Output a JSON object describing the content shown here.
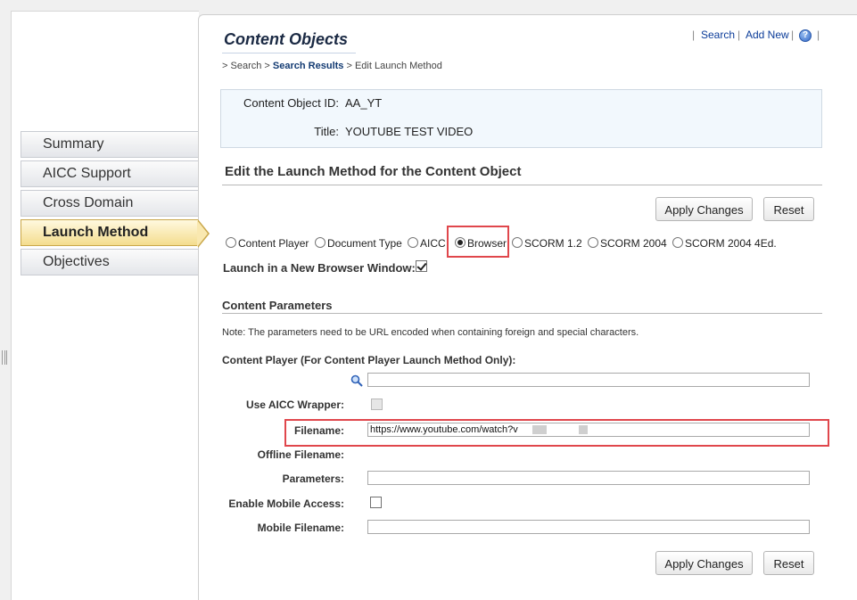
{
  "sidebar": {
    "items": [
      {
        "label": "Summary"
      },
      {
        "label": "AICC Support"
      },
      {
        "label": "Cross Domain"
      },
      {
        "label": "Launch Method"
      },
      {
        "label": "Objectives"
      }
    ],
    "active_index": 3
  },
  "header": {
    "title": "Content Objects",
    "links": {
      "search": "Search",
      "add_new": "Add New",
      "separator": "|"
    },
    "help_icon": "help-icon"
  },
  "breadcrumb": {
    "sep": ">",
    "items": [
      "Search",
      "Search Results",
      "Edit Launch Method"
    ]
  },
  "info": {
    "id_label": "Content Object ID:",
    "id_value": "AA_YT",
    "title_label": "Title:",
    "title_value": "YOUTUBE TEST VIDEO"
  },
  "edit": {
    "heading": "Edit the Launch Method for the Content Object",
    "apply_label": "Apply Changes",
    "reset_label": "Reset"
  },
  "launch_methods": {
    "options": [
      "Content Player",
      "Document Type",
      "AICC",
      "Browser",
      "SCORM 1.2",
      "SCORM 2004",
      "SCORM 2004 4Ed."
    ],
    "selected": "Browser"
  },
  "new_window": {
    "label": "Launch in a New Browser Window:",
    "checked": true
  },
  "params": {
    "heading": "Content Parameters",
    "note": "Note: The parameters need to be URL encoded when containing foreign and special characters.",
    "content_player_label": "Content Player (For Content Player Launch Method Only):",
    "content_player_value": "",
    "aicc_wrapper_label": "Use AICC Wrapper:",
    "aicc_wrapper_checked": false,
    "filename_label": "Filename:",
    "filename_value": "https://www.youtube.com/watch?v",
    "offline_filename_label": "Offline Filename:",
    "parameters_label": "Parameters:",
    "parameters_value": "",
    "mobile_access_label": "Enable Mobile Access:",
    "mobile_access_checked": false,
    "mobile_filename_label": "Mobile Filename:",
    "mobile_filename_value": ""
  },
  "colors": {
    "highlight": "#e0474c",
    "link": "#0b3c99",
    "active_tab": "#f4dd8e"
  }
}
